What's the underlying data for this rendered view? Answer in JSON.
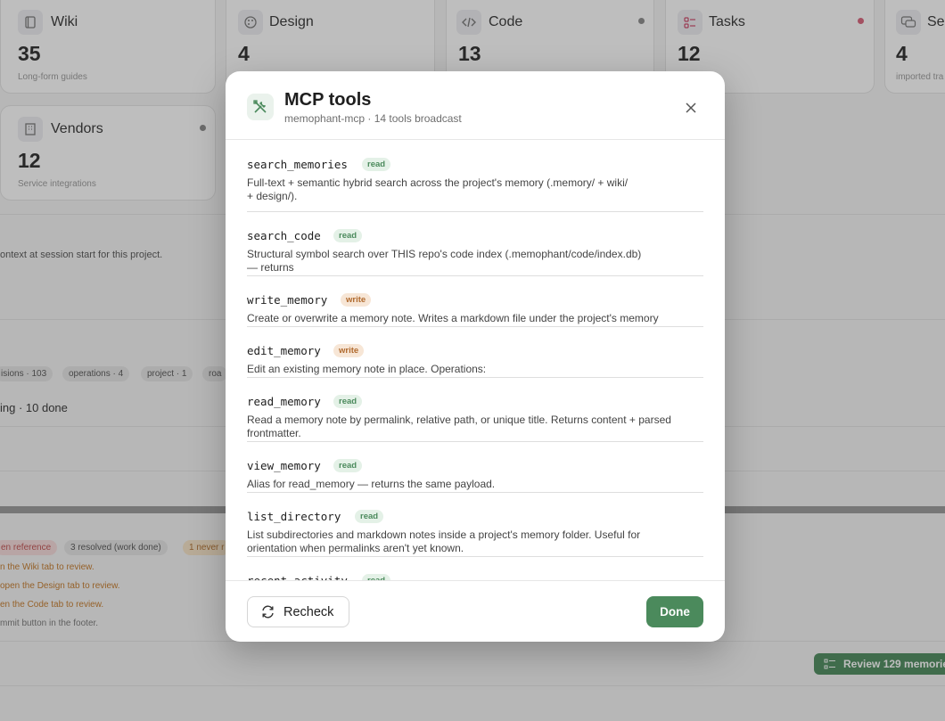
{
  "background": {
    "cards": [
      {
        "title": "Wiki",
        "count": "35",
        "subtitle": "Long-form guides"
      },
      {
        "title": "Design",
        "count": "4",
        "subtitle": ""
      },
      {
        "title": "Code",
        "count": "13",
        "subtitle": ""
      },
      {
        "title": "Tasks",
        "count": "12",
        "subtitle": ""
      },
      {
        "title": "Ses",
        "count": "4",
        "subtitle": "imported tra"
      },
      {
        "title": "Vendors",
        "count": "12",
        "subtitle": "Service integrations"
      }
    ],
    "context_text": "ontext at session start for this project.",
    "tags": [
      "isions · 103",
      "operations · 4",
      "project · 1",
      "roa"
    ],
    "tasks_summary": "ing · 10 done",
    "pills": [
      "en reference",
      "3 resolved (work done)",
      "1 never r"
    ],
    "hints": [
      "n the Wiki tab to review.",
      "open the Design tab to review.",
      "en the Code tab to review.",
      "mmit button in the footer."
    ],
    "review_button": "Review 129 memorie",
    "colors": {
      "dot_gray": "#8a8a8a",
      "dot_red": "#d9627a",
      "accent_green": "#4b8a5c"
    }
  },
  "modal": {
    "title": "MCP tools",
    "subtitle": "memophant-mcp · 14 tools broadcast",
    "close_icon": "close-icon",
    "tools": [
      {
        "name": "search_memories",
        "access": "read",
        "desc": "Full-text + semantic hybrid search across the project's memory (.memory/ + wiki/ + design/)."
      },
      {
        "name": "search_code",
        "access": "read",
        "desc": "Structural symbol search over THIS repo's code index (.memophant/code/index.db) — returns"
      },
      {
        "name": "write_memory",
        "access": "write",
        "desc": "Create or overwrite a memory note. Writes a markdown file under the project's memory"
      },
      {
        "name": "edit_memory",
        "access": "write",
        "desc": "Edit an existing memory note in place. Operations:"
      },
      {
        "name": "read_memory",
        "access": "read",
        "desc": "Read a memory note by permalink, relative path, or unique title. Returns content + parsed frontmatter."
      },
      {
        "name": "view_memory",
        "access": "read",
        "desc": "Alias for read_memory — returns the same payload."
      },
      {
        "name": "list_directory",
        "access": "read",
        "desc": "List subdirectories and markdown notes inside a project's memory folder. Useful for orientation when permalinks aren't yet known."
      },
      {
        "name": "recent_activity",
        "access": "read",
        "desc": ""
      }
    ],
    "footer": {
      "recheck_label": "Recheck",
      "done_label": "Done"
    }
  }
}
